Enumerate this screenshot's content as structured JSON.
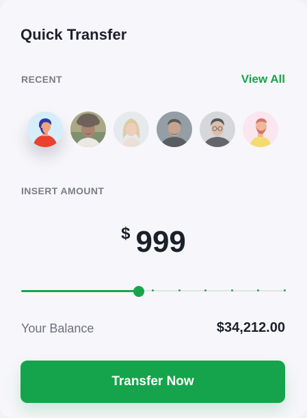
{
  "card": {
    "title": "Quick Transfer"
  },
  "recent": {
    "label": "RECENT",
    "view_all_label": "View All",
    "contacts": [
      {
        "avatar": "avatar-illustrated-man-red",
        "selected": true
      },
      {
        "avatar": "avatar-photo-man-curly-hair",
        "selected": false
      },
      {
        "avatar": "avatar-photo-woman-blonde",
        "selected": false
      },
      {
        "avatar": "avatar-photo-man-dark-shirt",
        "selected": false
      },
      {
        "avatar": "avatar-photo-man-glasses",
        "selected": false
      },
      {
        "avatar": "avatar-illustrated-man-yellow",
        "selected": false
      }
    ]
  },
  "amount": {
    "label": "INSERT AMOUNT",
    "currency": "$",
    "value": "999",
    "slider_fraction": 0.445,
    "slider_steps": 10
  },
  "balance": {
    "label": "Your Balance",
    "value": "$34,212.00"
  },
  "actions": {
    "transfer_label": "Transfer Now"
  },
  "colors": {
    "accent": "#17a54a",
    "text": "#1c2029",
    "muted": "#7a7d86",
    "card_bg": "#f7f6fa"
  }
}
